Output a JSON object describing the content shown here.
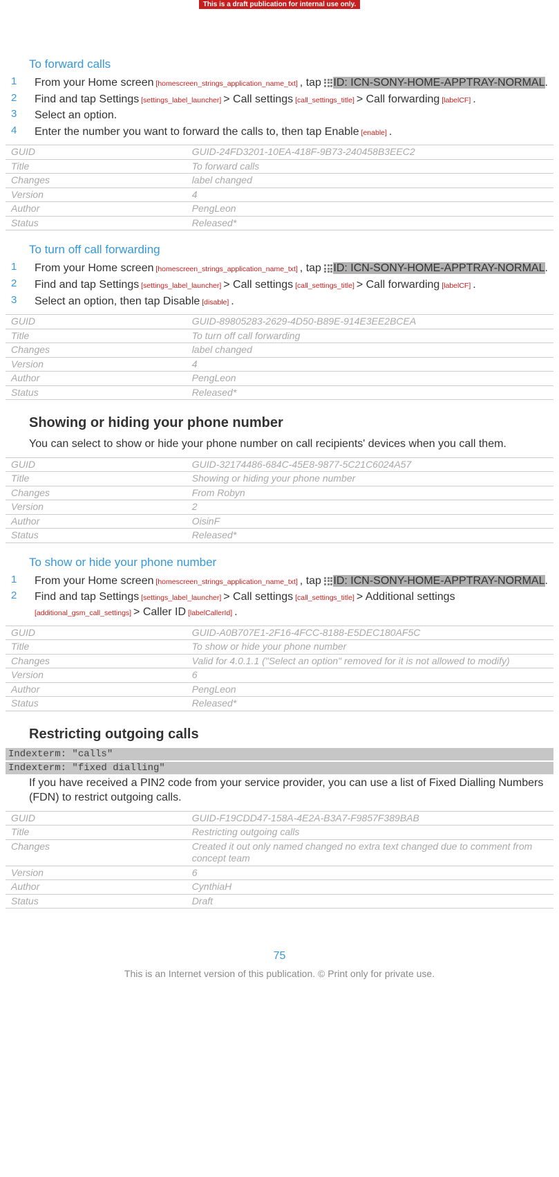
{
  "banner": "This is a draft publication for internal use only.",
  "sections": {
    "forward": {
      "title": "To forward calls",
      "steps": {
        "s1a": "From your ",
        "s1b": "Home screen",
        "s1tag1": " [homescreen_strings_application_name_txt] ",
        "s1c": ", tap ",
        "s1icon": "ID: ICN-SONY-HOME-APPTRAY-NORMAL",
        "s1d": ".",
        "s2a": "Find and tap ",
        "s2b": "Settings",
        "s2tag1": " [settings_label_launcher] ",
        "s2c": "> ",
        "s2d": "Call settings",
        "s2tag2": " [call_settings_title] ",
        "s2e": "> ",
        "s2f": "Call forwarding",
        "s2tag3": " [labelCF] ",
        "s2g": ".",
        "s3": "Select an option.",
        "s4a": "Enter the number you want to forward the calls to, then tap ",
        "s4b": "Enable",
        "s4tag": " [enable] ",
        "s4c": "."
      },
      "meta": {
        "GUID": "GUID-24FD3201-10EA-418F-9B73-240458B3EEC2",
        "Title": "To forward calls",
        "Changes": "label changed",
        "Version": "4",
        "Author": "PengLeon",
        "Status": "Released*"
      }
    },
    "turnoff": {
      "title": "To turn off call forwarding",
      "steps": {
        "s1a": "From your ",
        "s1b": "Home screen",
        "s1tag1": " [homescreen_strings_application_name_txt] ",
        "s1c": ", tap ",
        "s1icon": "ID: ICN-SONY-HOME-APPTRAY-NORMAL",
        "s1d": ".",
        "s2a": "Find and tap ",
        "s2b": "Settings",
        "s2tag1": " [settings_label_launcher] ",
        "s2c": "> ",
        "s2d": "Call settings",
        "s2tag2": " [call_settings_title] ",
        "s2e": "> ",
        "s2f": "Call forwarding",
        "s2tag3": " [labelCF] ",
        "s2g": ".",
        "s3a": "Select an option, then tap ",
        "s3b": "Disable",
        "s3tag": " [disable] ",
        "s3c": "."
      },
      "meta": {
        "GUID": "GUID-89805283-2629-4D50-B89E-914E3EE2BCEA",
        "Title": "To turn off call forwarding",
        "Changes": "label changed",
        "Version": "4",
        "Author": "PengLeon",
        "Status": "Released*"
      }
    },
    "showhide_intro": {
      "title": "Showing or hiding your phone number",
      "body": "You can select to show or hide your phone number on call recipients' devices when you call them.",
      "meta": {
        "GUID": "GUID-32174486-684C-45E8-9877-5C21C6024A57",
        "Title": "Showing or hiding your phone number",
        "Changes": "From Robyn",
        "Version": "2",
        "Author": "OisinF",
        "Status": "Released*"
      }
    },
    "showhide": {
      "title": "To show or hide your phone number",
      "steps": {
        "s1a": "From your ",
        "s1b": "Home screen",
        "s1tag1": " [homescreen_strings_application_name_txt] ",
        "s1c": ", tap ",
        "s1icon": "ID: ICN-SONY-HOME-APPTRAY-NORMAL",
        "s1d": ".",
        "s2a": "Find and tap ",
        "s2b": "Settings",
        "s2tag1": " [settings_label_launcher] ",
        "s2c": "> ",
        "s2d": "Call settings",
        "s2tag2": " [call_settings_title] ",
        "s2e": "> ",
        "s2f": "Additional settings",
        "s2tag3": " [additional_gsm_call_settings] ",
        "s2g": "> ",
        "s2h": "Caller ID",
        "s2tag4": " [labelCallerId] ",
        "s2i": "."
      },
      "meta": {
        "GUID": "GUID-A0B707E1-2F16-4FCC-8188-E5DEC180AF5C",
        "Title": "To show or hide your phone number",
        "Changes": "Valid for 4.0.1.1 (\"Select an option\" removed for it is not allowed to modify)",
        "Version": "6",
        "Author": "PengLeon",
        "Status": "Released*"
      }
    },
    "restrict": {
      "title": "Restricting outgoing calls",
      "indexterm1": "Indexterm: \"calls\"",
      "indexterm2": "Indexterm: \"fixed dialling\"",
      "body": "If you have received a PIN2 code from your service provider, you can use a list of Fixed Dialling Numbers (FDN) to restrict outgoing calls.",
      "meta": {
        "GUID": "GUID-F19CDD47-158A-4E2A-B3A7-F9857F389BAB",
        "Title": "Restricting outgoing calls",
        "Changes": "Created it out only named changed no extra text changed due to comment from concept team",
        "Version": "6",
        "Author": "CynthiaH",
        "Status": "Draft"
      }
    }
  },
  "labels": {
    "guid": "GUID",
    "title": "Title",
    "changes": "Changes",
    "version": "Version",
    "author": "Author",
    "status": "Status"
  },
  "page_num": "75",
  "footer": "This is an Internet version of this publication. © Print only for private use."
}
